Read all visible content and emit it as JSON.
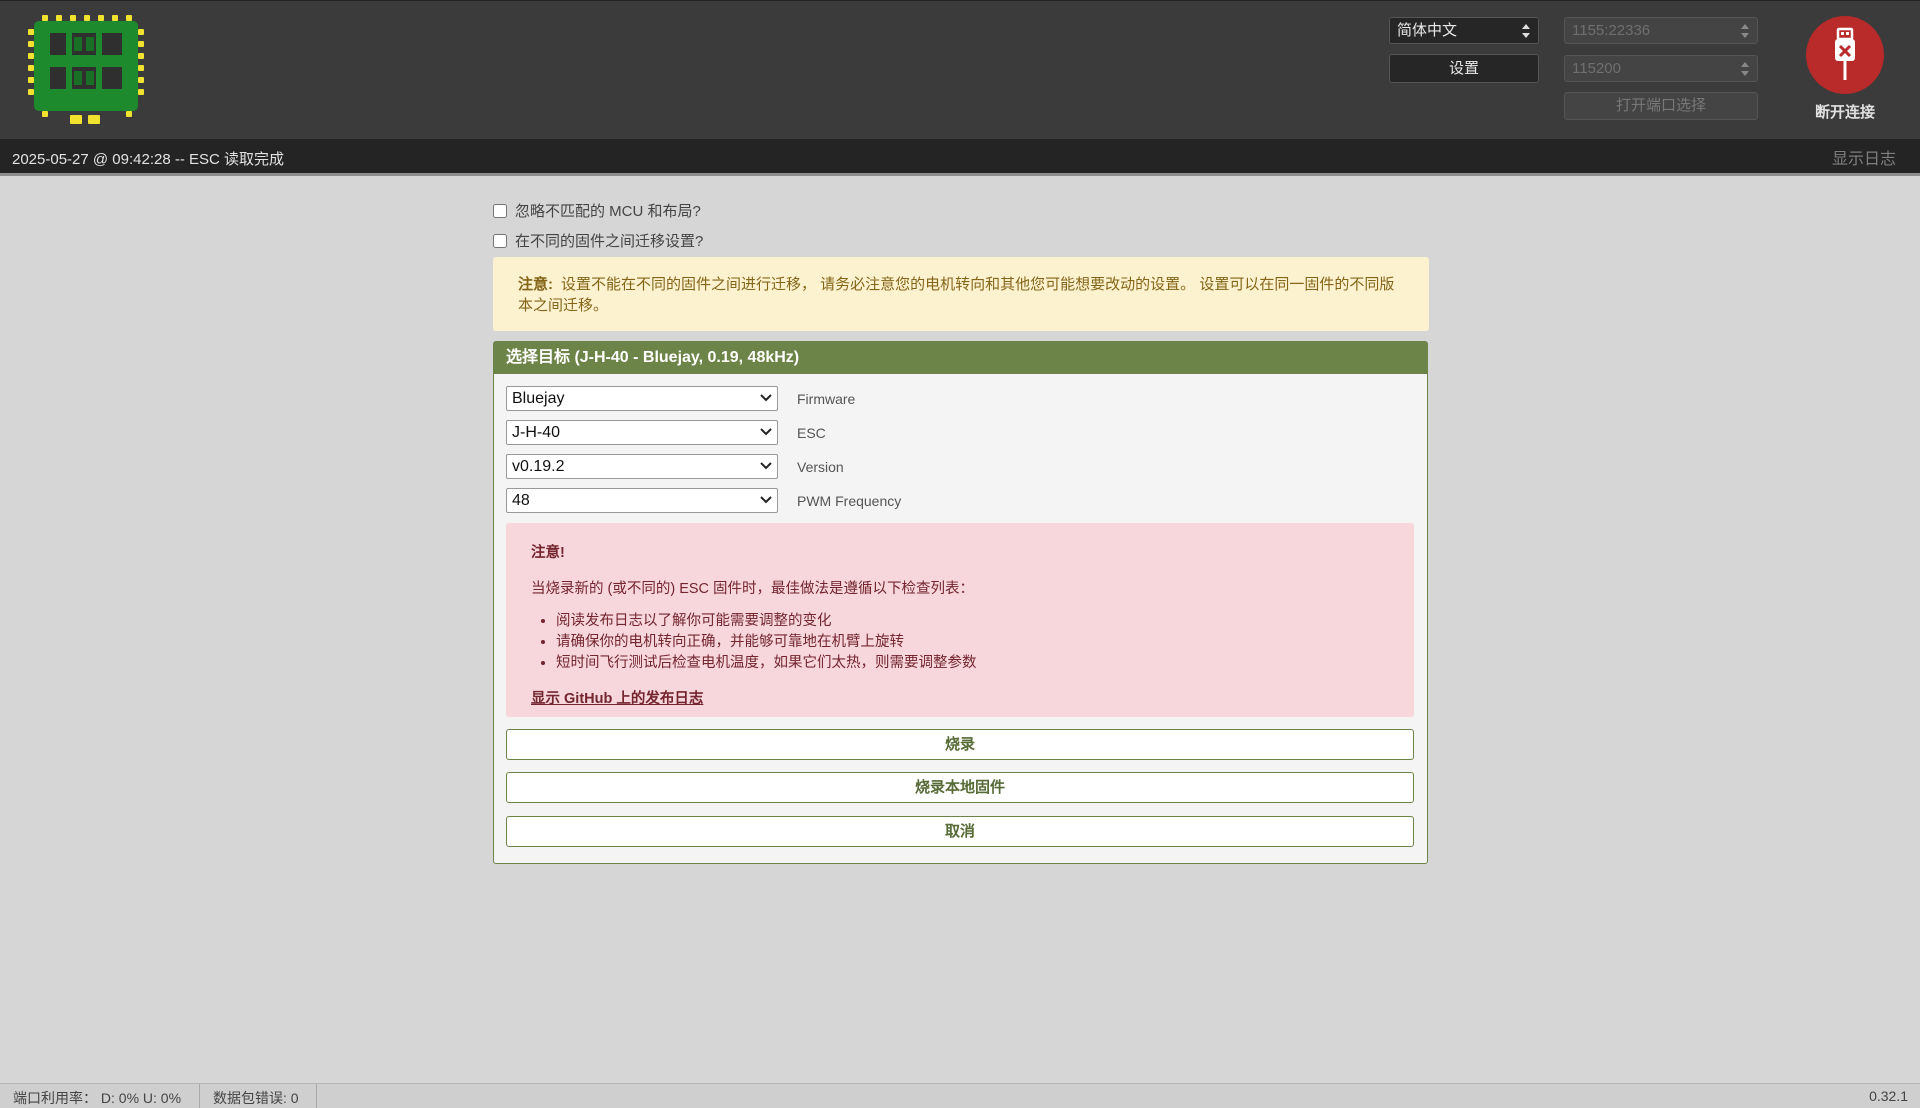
{
  "header": {
    "language_select": "简体中文",
    "settings_button": "设置",
    "port_select": "1155:22336",
    "baud_select": "115200",
    "open_port_button": "打开端口选择",
    "connect_label": "断开连接",
    "colors": {
      "header_bg": "#3b3b3b",
      "connect_red": "#b92a2a",
      "pcb_green": "#1e8a2e",
      "pad_yellow": "#f2e230"
    }
  },
  "statusbar": {
    "message": "2025-05-27 @ 09:42:28 -- ESC 读取完成",
    "show_log": "显示日志"
  },
  "options": {
    "ignore_mcu": "忽略不匹配的 MCU 和布局?",
    "migrate_settings": "在不同的固件之间迁移设置?"
  },
  "notice": {
    "label": "注意:",
    "text": "设置不能在不同的固件之间进行迁移， 请务必注意您的电机转向和其他您可能想要改动的设置。 设置可以在同一固件的不同版本之间迁移。"
  },
  "panel": {
    "title": "选择目标 (J-H-40 - Bluejay, 0.19, 48kHz)",
    "accent": "#6c8447",
    "fields": [
      {
        "value": "Bluejay",
        "label": "Firmware"
      },
      {
        "value": "J-H-40",
        "label": "ESC"
      },
      {
        "value": "v0.19.2",
        "label": "Version"
      },
      {
        "value": "48",
        "label": "PWM Frequency"
      }
    ],
    "warning": {
      "title": "注意!",
      "body": "当烧录新的 (或不同的) ESC 固件时，最佳做法是遵循以下检查列表：",
      "items": [
        "阅读发布日志以了解你可能需要调整的变化",
        "请确保你的电机转向正确，并能够可靠地在机臂上旋转",
        "短时间飞行测试后检查电机温度，如果它们太热，则需要调整参数"
      ],
      "link": "显示 GitHub 上的发布日志"
    },
    "buttons": {
      "flash": "烧录",
      "flash_local": "烧录本地固件",
      "cancel": "取消"
    }
  },
  "footer": {
    "port_usage": "端口利用率： D: 0% U: 0%",
    "packet_errors": "数据包错误: 0",
    "version": "0.32.1"
  }
}
